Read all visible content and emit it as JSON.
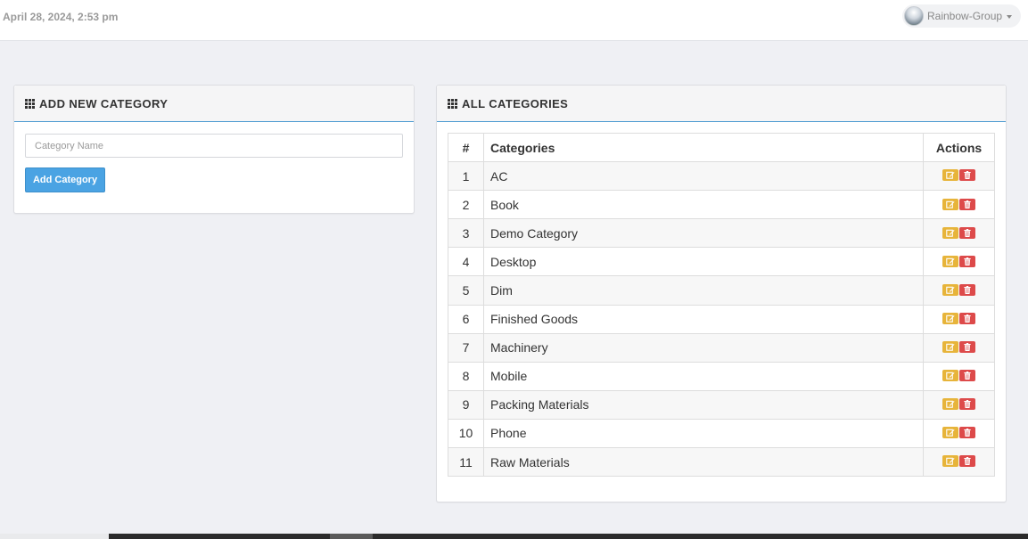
{
  "header": {
    "datetime": "April 28, 2024, 2:53 pm",
    "user_name": "Rainbow-Group"
  },
  "add_panel": {
    "title": "ADD NEW CATEGORY",
    "input_placeholder": "Category Name",
    "input_value": "",
    "button_label": "Add Category"
  },
  "all_panel": {
    "title": "ALL CATEGORIES",
    "columns": [
      "#",
      "Categories",
      "Actions"
    ],
    "rows": [
      {
        "num": "1",
        "name": "AC"
      },
      {
        "num": "2",
        "name": "Book"
      },
      {
        "num": "3",
        "name": "Demo Category"
      },
      {
        "num": "4",
        "name": "Desktop"
      },
      {
        "num": "5",
        "name": "Dim"
      },
      {
        "num": "6",
        "name": "Finished Goods"
      },
      {
        "num": "7",
        "name": "Machinery"
      },
      {
        "num": "8",
        "name": "Mobile"
      },
      {
        "num": "9",
        "name": "Packing Materials"
      },
      {
        "num": "10",
        "name": "Phone"
      },
      {
        "num": "11",
        "name": "Raw Materials"
      }
    ]
  },
  "icons": {
    "panel": "grid-icon",
    "edit": "edit-icon",
    "delete": "trash-icon",
    "caret": "caret-down-icon"
  },
  "colors": {
    "primary_button": "#4aa3e3",
    "edit_button": "#e7b43a",
    "delete_button": "#dd4a4a",
    "heading_underline": "#4b9ad0"
  }
}
